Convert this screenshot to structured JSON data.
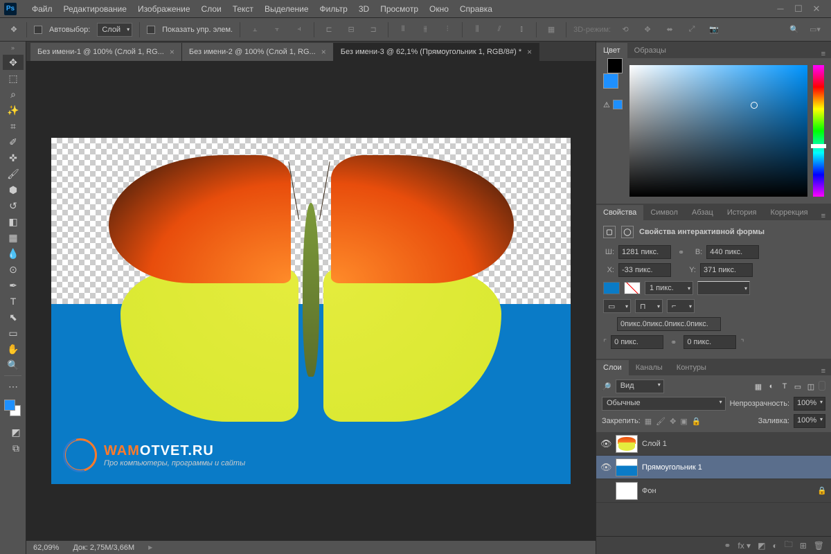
{
  "menu": {
    "items": [
      "Файл",
      "Редактирование",
      "Изображение",
      "Слои",
      "Текст",
      "Выделение",
      "Фильтр",
      "3D",
      "Просмотр",
      "Окно",
      "Справка"
    ]
  },
  "options": {
    "auto_select": "Автовыбор:",
    "layer_dropdown": "Слой",
    "show_transform": "Показать упр. элем.",
    "mode_3d": "3D-режим:"
  },
  "docs": {
    "tabs": [
      {
        "label": "Без имени-1 @ 100% (Слой 1, RG...",
        "active": false
      },
      {
        "label": "Без имени-2 @ 100% (Слой 1, RG...",
        "active": false
      },
      {
        "label": "Без имени-3 @ 62,1% (Прямоугольник 1, RGB/8#) *",
        "active": true
      }
    ]
  },
  "watermark": {
    "brand_a": "WAM",
    "brand_b": "OTVET.RU",
    "sub": "Про компьютеры, программы и сайты"
  },
  "status": {
    "zoom": "62,09%",
    "doc": "Док: 2,75M/3,66M"
  },
  "color_panel": {
    "tabs": [
      "Цвет",
      "Образцы"
    ],
    "fg": "#1e90ff",
    "bg": "#000000"
  },
  "props_panel": {
    "tabs": [
      "Свойства",
      "Символ",
      "Абзац",
      "История",
      "Коррекция"
    ],
    "header": "Свойства интерактивной формы",
    "w_lbl": "Ш:",
    "w": "1281 пикс.",
    "h_lbl": "В:",
    "h": "440 пикс.",
    "x_lbl": "X:",
    "x": "-33 пикс.",
    "y_lbl": "Y:",
    "y": "371 пикс.",
    "stroke_width": "1 пикс.",
    "fill_color": "#0a7bc7",
    "corners_summary": "0пикс.0пикс.0пикс.0пикс.",
    "corner_a": "0 пикс.",
    "corner_b": "0 пикс."
  },
  "layers_panel": {
    "tabs": [
      "Слои",
      "Каналы",
      "Контуры"
    ],
    "filter": "Вид",
    "blend": "Обычные",
    "opacity_lbl": "Непрозрачность:",
    "opacity": "100%",
    "lock_lbl": "Закрепить:",
    "fill_lbl": "Заливка:",
    "fill": "100%",
    "layers": [
      {
        "name": "Слой 1",
        "visible": true,
        "selected": false,
        "kind": "butterfly"
      },
      {
        "name": "Прямоугольник 1",
        "visible": true,
        "selected": true,
        "kind": "blue"
      },
      {
        "name": "Фон",
        "visible": false,
        "selected": false,
        "kind": "white"
      }
    ]
  }
}
